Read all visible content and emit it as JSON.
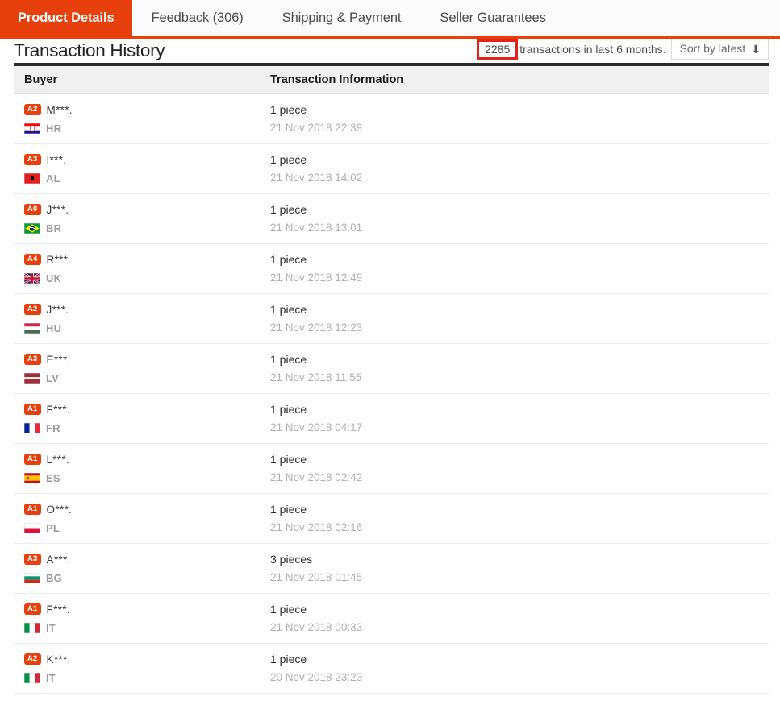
{
  "tabs": [
    {
      "label": "Product Details",
      "active": true
    },
    {
      "label": "Feedback (306)",
      "active": false
    },
    {
      "label": "Shipping & Payment",
      "active": false
    },
    {
      "label": "Seller Guarantees",
      "active": false
    }
  ],
  "header": {
    "title": "Transaction History",
    "transaction_count": "2285",
    "count_suffix": "transactions in last 6 months.",
    "sort_label": "Sort by latest",
    "sort_icon": "arrow-down-icon"
  },
  "table": {
    "columns": [
      "Buyer",
      "Transaction Information"
    ],
    "rows": [
      {
        "badge": "A2",
        "name": "M***.",
        "country": "HR",
        "flag": "croatia-flag",
        "qty": "1 piece",
        "datetime": "21 Nov 2018 22:39"
      },
      {
        "badge": "A3",
        "name": "I***.",
        "country": "AL",
        "flag": "albania-flag",
        "qty": "1 piece",
        "datetime": "21 Nov 2018 14:02"
      },
      {
        "badge": "A0",
        "name": "J***.",
        "country": "BR",
        "flag": "brazil-flag",
        "qty": "1 piece",
        "datetime": "21 Nov 2018 13:01"
      },
      {
        "badge": "A4",
        "name": "R***.",
        "country": "UK",
        "flag": "uk-flag",
        "qty": "1 piece",
        "datetime": "21 Nov 2018 12:49"
      },
      {
        "badge": "A2",
        "name": "J***.",
        "country": "HU",
        "flag": "hungary-flag",
        "qty": "1 piece",
        "datetime": "21 Nov 2018 12:23"
      },
      {
        "badge": "A3",
        "name": "E***.",
        "country": "LV",
        "flag": "latvia-flag",
        "qty": "1 piece",
        "datetime": "21 Nov 2018 11:55"
      },
      {
        "badge": "A1",
        "name": "F***.",
        "country": "FR",
        "flag": "france-flag",
        "qty": "1 piece",
        "datetime": "21 Nov 2018 04:17"
      },
      {
        "badge": "A1",
        "name": "L***.",
        "country": "ES",
        "flag": "spain-flag",
        "qty": "1 piece",
        "datetime": "21 Nov 2018 02:42"
      },
      {
        "badge": "A1",
        "name": "O***.",
        "country": "PL",
        "flag": "poland-flag",
        "qty": "1 piece",
        "datetime": "21 Nov 2018 02:16"
      },
      {
        "badge": "A3",
        "name": "A***.",
        "country": "BG",
        "flag": "bulgaria-flag",
        "qty": "3 pieces",
        "datetime": "21 Nov 2018 01:45"
      },
      {
        "badge": "A1",
        "name": "F***.",
        "country": "IT",
        "flag": "italy-flag",
        "qty": "1 piece",
        "datetime": "21 Nov 2018 00:33"
      },
      {
        "badge": "A2",
        "name": "K***.",
        "country": "IT",
        "flag": "italy-flag",
        "qty": "1 piece",
        "datetime": "20 Nov 2018 23:23"
      }
    ]
  },
  "colors": {
    "accent": "#e8400c",
    "annotation": "#e8201a",
    "header_bg": "#f0f0f0",
    "divider": "#2b2b2b"
  }
}
